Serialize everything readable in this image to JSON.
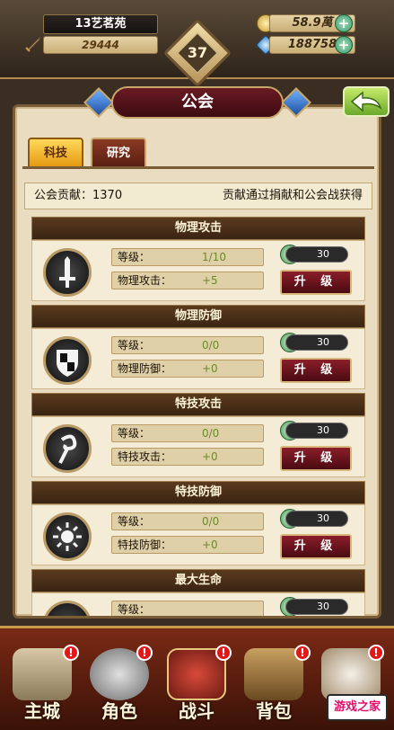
{
  "player": {
    "name": "13艺茗苑",
    "power": "29444",
    "level": "37"
  },
  "resources": {
    "gold": "58.9萬",
    "gems": "188758"
  },
  "page": {
    "title": "公会"
  },
  "tabs": [
    {
      "label": "科技",
      "active": true
    },
    {
      "label": "研究",
      "active": false
    }
  ],
  "contribution": {
    "label": "公会贡献：1370",
    "hint": "贡献通过捐献和公会战获得"
  },
  "skills": [
    {
      "header": "物理攻击",
      "icon": "sword-icon",
      "level_label": "等级：",
      "level_value": "1/10",
      "stat_label": "物理攻击：",
      "stat_value": "+5",
      "cost": "30",
      "button": "升 级"
    },
    {
      "header": "物理防御",
      "icon": "shield-icon",
      "level_label": "等级：",
      "level_value": "0/0",
      "stat_label": "物理防御：",
      "stat_value": "+0",
      "cost": "30",
      "button": "升 级"
    },
    {
      "header": "特技攻击",
      "icon": "swirl-icon",
      "level_label": "等级：",
      "level_value": "0/0",
      "stat_label": "特技攻击：",
      "stat_value": "+0",
      "cost": "30",
      "button": "升 级"
    },
    {
      "header": "特技防御",
      "icon": "sun-icon",
      "level_label": "等级：",
      "level_value": "0/0",
      "stat_label": "特技防御：",
      "stat_value": "+0",
      "cost": "30",
      "button": "升 级"
    },
    {
      "header": "最大生命",
      "icon": "heart-icon",
      "level_label": "等级：",
      "level_value": "",
      "stat_label": "",
      "stat_value": "",
      "cost": "30",
      "button": ""
    }
  ],
  "nav": [
    {
      "label": "主城",
      "icon": "castle-icon",
      "badge": "!"
    },
    {
      "label": "角色",
      "icon": "helmet-icon",
      "badge": "!"
    },
    {
      "label": "战斗",
      "icon": "battle-shield-icon",
      "badge": "!"
    },
    {
      "label": "背包",
      "icon": "backpack-icon",
      "badge": "!"
    },
    {
      "label": "",
      "icon": "chef-icon",
      "badge": "!"
    }
  ],
  "brand": {
    "label": "游戏之家"
  },
  "colors": {
    "accent_gold": "#e59a12",
    "upgrade_red": "#8a1e2a",
    "value_green": "#6a8a2a"
  }
}
